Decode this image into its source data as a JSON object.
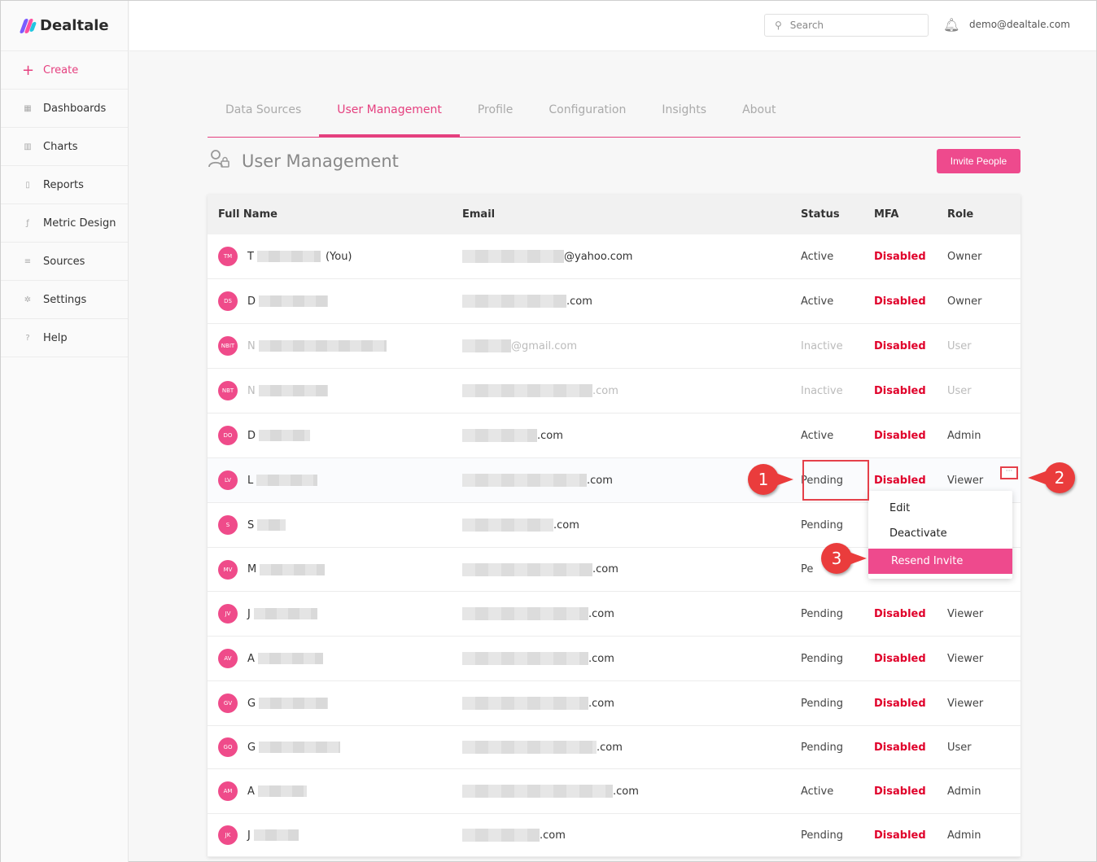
{
  "app": {
    "name": "Dealtale"
  },
  "sidebar": {
    "items": [
      {
        "label": "Create",
        "icon": "plus-icon"
      },
      {
        "label": "Dashboards",
        "icon": "grid-icon"
      },
      {
        "label": "Charts",
        "icon": "chart-icon"
      },
      {
        "label": "Reports",
        "icon": "document-icon"
      },
      {
        "label": "Metric Design",
        "icon": "function-icon"
      },
      {
        "label": "Sources",
        "icon": "database-icon"
      },
      {
        "label": "Settings",
        "icon": "gear-icon"
      },
      {
        "label": "Help",
        "icon": "help-icon"
      }
    ]
  },
  "topbar": {
    "search_placeholder": "Search",
    "user_email": "demo@dealtale.com"
  },
  "tabs": [
    "Data Sources",
    "User Management",
    "Profile",
    "Configuration",
    "Insights",
    "About"
  ],
  "active_tab": "User Management",
  "section": {
    "title": "User Management",
    "invite_label": "Invite People"
  },
  "table": {
    "headers": {
      "name": "Full Name",
      "email": "Email",
      "status": "Status",
      "mfa": "MFA",
      "role": "Role"
    },
    "rows": [
      {
        "initials": "TM",
        "name_initial": "T",
        "you": "(You)",
        "email_domain": "@yahoo.com",
        "status": "Active",
        "mfa": "Disabled",
        "role": "Owner"
      },
      {
        "initials": "DS",
        "name_initial": "D",
        "you": "",
        "email_domain": ".com",
        "status": "Active",
        "mfa": "Disabled",
        "role": "Owner"
      },
      {
        "initials": "NBIT",
        "name_initial": "N",
        "you": "",
        "email_domain": "@gmail.com",
        "status": "Inactive",
        "mfa": "Disabled",
        "role": "User"
      },
      {
        "initials": "NBT",
        "name_initial": "N",
        "you": "",
        "email_domain": ".com",
        "status": "Inactive",
        "mfa": "Disabled",
        "role": "User"
      },
      {
        "initials": "DO",
        "name_initial": "D",
        "you": "",
        "email_domain": ".com",
        "status": "Active",
        "mfa": "Disabled",
        "role": "Admin"
      },
      {
        "initials": "LV",
        "name_initial": "L",
        "you": "",
        "email_domain": ".com",
        "status": "Pending",
        "mfa": "Disabled",
        "role": "Viewer"
      },
      {
        "initials": "S",
        "name_initial": "S",
        "you": "",
        "email_domain": ".com",
        "status": "Pending",
        "mfa": "",
        "role": ""
      },
      {
        "initials": "MV",
        "name_initial": "M",
        "you": "",
        "email_domain": ".com",
        "status": "Pe",
        "mfa": "",
        "role": ""
      },
      {
        "initials": "JV",
        "name_initial": "J",
        "you": "",
        "email_domain": ".com",
        "status": "Pending",
        "mfa": "Disabled",
        "role": "Viewer"
      },
      {
        "initials": "AV",
        "name_initial": "A",
        "you": "",
        "email_domain": ".com",
        "status": "Pending",
        "mfa": "Disabled",
        "role": "Viewer"
      },
      {
        "initials": "GV",
        "name_initial": "G",
        "you": "",
        "email_domain": ".com",
        "status": "Pending",
        "mfa": "Disabled",
        "role": "Viewer"
      },
      {
        "initials": "GO",
        "name_initial": "G",
        "you": "",
        "email_domain": ".com",
        "status": "Pending",
        "mfa": "Disabled",
        "role": "User"
      },
      {
        "initials": "AM",
        "name_initial": "A",
        "you": "",
        "email_domain": ".com",
        "status": "Active",
        "mfa": "Disabled",
        "role": "Admin"
      },
      {
        "initials": "JK",
        "name_initial": "J",
        "you": "",
        "email_domain": ".com",
        "status": "Pending",
        "mfa": "Disabled",
        "role": "Admin"
      }
    ]
  },
  "row_menu": {
    "items": [
      "Edit",
      "Deactivate",
      "Resend Invite"
    ],
    "more_label": "···"
  },
  "callouts": [
    "1",
    "2",
    "3"
  ],
  "colors": {
    "accent": "#ee4a8d",
    "mfa_disabled": "#e0002a",
    "callout": "#ea3c3c"
  }
}
